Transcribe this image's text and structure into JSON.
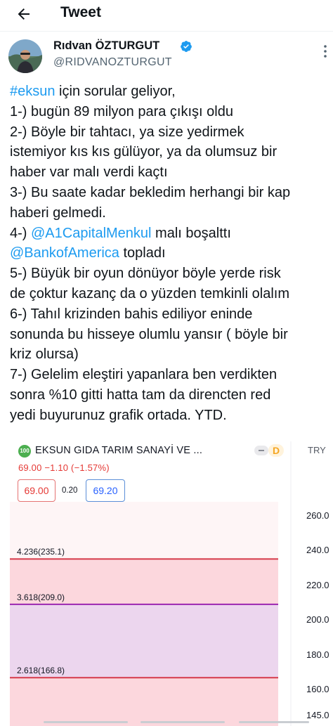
{
  "header": {
    "title": "Tweet"
  },
  "author": {
    "name": "Rıdvan ÖZTURGUT",
    "handle": "@RIDVANOZTURGUT"
  },
  "tweet": {
    "lines": [
      {
        "parts": [
          {
            "text": "#eksun",
            "link": true
          },
          {
            "text": " için sorular geliyor,",
            "link": false
          }
        ]
      },
      {
        "parts": [
          {
            "text": "1-) bugün 89 milyon para çıkışı oldu",
            "link": false
          }
        ]
      },
      {
        "parts": [
          {
            "text": "2-) Böyle bir tahtacı, ya size yedirmek",
            "link": false
          }
        ]
      },
      {
        "parts": [
          {
            "text": "istemiyor kıs kıs gülüyor, ya da olumsuz bir",
            "link": false
          }
        ]
      },
      {
        "parts": [
          {
            "text": "haber var malı verdi kaçtı",
            "link": false
          }
        ]
      },
      {
        "parts": [
          {
            "text": "3-) Bu saate kadar bekledim herhangi bir kap",
            "link": false
          }
        ]
      },
      {
        "parts": [
          {
            "text": "haberi gelmedi.",
            "link": false
          }
        ]
      },
      {
        "parts": [
          {
            "text": "4-) ",
            "link": false
          },
          {
            "text": "@A1CapitalMenkul",
            "link": true
          },
          {
            "text": " malı boşalttı",
            "link": false
          }
        ]
      },
      {
        "parts": [
          {
            "text": "@BankofAmerica",
            "link": true
          },
          {
            "text": " topladı",
            "link": false
          }
        ]
      },
      {
        "parts": [
          {
            "text": "5-) Büyük bir oyun dönüyor böyle yerde risk",
            "link": false
          }
        ]
      },
      {
        "parts": [
          {
            "text": "de çoktur kazanç da  o yüzden temkinli olalım",
            "link": false
          }
        ]
      },
      {
        "parts": [
          {
            "text": "6-) Tahıl krizinden bahis ediliyor eninde",
            "link": false
          }
        ]
      },
      {
        "parts": [
          {
            "text": "sonunda bu hisseye olumlu yansır ( böyle bir",
            "link": false
          }
        ]
      },
      {
        "parts": [
          {
            "text": "kriz olursa)",
            "link": false
          }
        ]
      },
      {
        "parts": [
          {
            "text": "7-) Gelelim eleştiri yapanlara ben verdikten",
            "link": false
          }
        ]
      },
      {
        "parts": [
          {
            "text": "sonra %10 gitti hatta tam da direncten red",
            "link": false
          }
        ]
      },
      {
        "parts": [
          {
            "text": "yedi buyurunuz grafik ortada. YTD.",
            "link": false
          }
        ]
      }
    ]
  },
  "chart_image": {
    "symbol_badge": "100",
    "symbol_title": "EKSUN GIDA TARIM SANAYİ VE ...",
    "interval_badge": "D",
    "currency": "TRY",
    "quote": "69.00  −1.10 (−1.57%)",
    "bid": "69.00",
    "spread": "0.20",
    "ask": "69.20",
    "colors": {
      "red_band": "#fcd7dd",
      "purple_band": "#ecd6ee",
      "red_line": "#d63a4a",
      "purple_line": "#9c27b0"
    }
  },
  "chart_data": {
    "type": "line",
    "title": "EKSUN GIDA TARIM SANAYİ VE ...",
    "y_axis": {
      "ticks": [
        "260.0",
        "240.0",
        "220.0",
        "200.0",
        "180.0",
        "160.0",
        "145.0"
      ],
      "tick_values": [
        260,
        240,
        220,
        200,
        180,
        160,
        145
      ],
      "ylim": [
        141,
        268
      ]
    },
    "levels": [
      {
        "label": "4.236(235.1)",
        "ratio": 4.236,
        "value": 235.1,
        "color": "#d63a4a"
      },
      {
        "label": "3.618(209.0)",
        "ratio": 3.618,
        "value": 209.0,
        "color": "#9c27b0"
      },
      {
        "label": "2.618(166.8)",
        "ratio": 2.618,
        "value": 166.8,
        "color": "#d63a4a"
      }
    ]
  }
}
